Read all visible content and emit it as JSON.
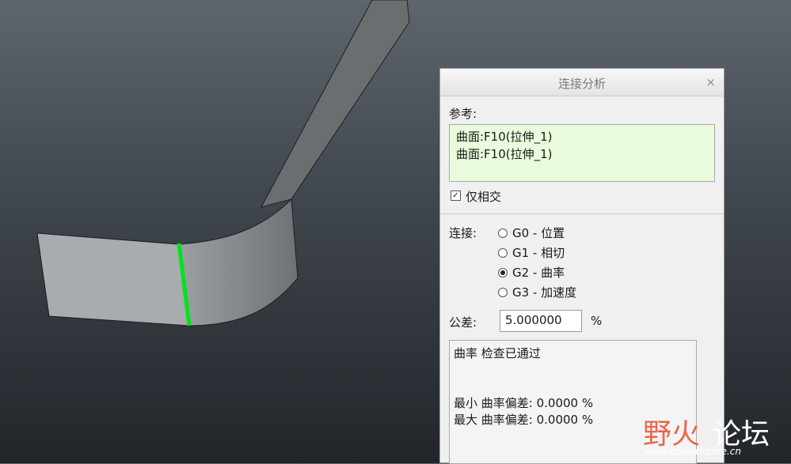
{
  "dialog": {
    "title": "连接分析",
    "close": "×",
    "reference_label": "参考:",
    "references": [
      "曲面:F10(拉伸_1)",
      "曲面:F10(拉伸_1)"
    ],
    "intersect_only": {
      "label": "仅相交",
      "checked": true
    },
    "connection_label": "连接:",
    "options": [
      {
        "label": "G0 - 位置",
        "selected": false
      },
      {
        "label": "G1 - 相切",
        "selected": false
      },
      {
        "label": "G2 - 曲率",
        "selected": true
      },
      {
        "label": "G3 - 加速度",
        "selected": false
      }
    ],
    "tolerance_label": "公差:",
    "tolerance_value": "5.000000",
    "tolerance_unit": "%",
    "result": {
      "status": "曲率 检查已通过",
      "min_line": "最小 曲率偏差: 0.0000 %",
      "max_line": "最大 曲率偏差: 0.0000 %"
    }
  },
  "watermark": {
    "brand_a": "野火",
    "brand_b": "论坛",
    "url": "www.proewildfire.cn"
  },
  "colors": {
    "highlight_edge": "#00e31a",
    "surface": "#a8abad",
    "accent_logo": "#e8684a"
  }
}
